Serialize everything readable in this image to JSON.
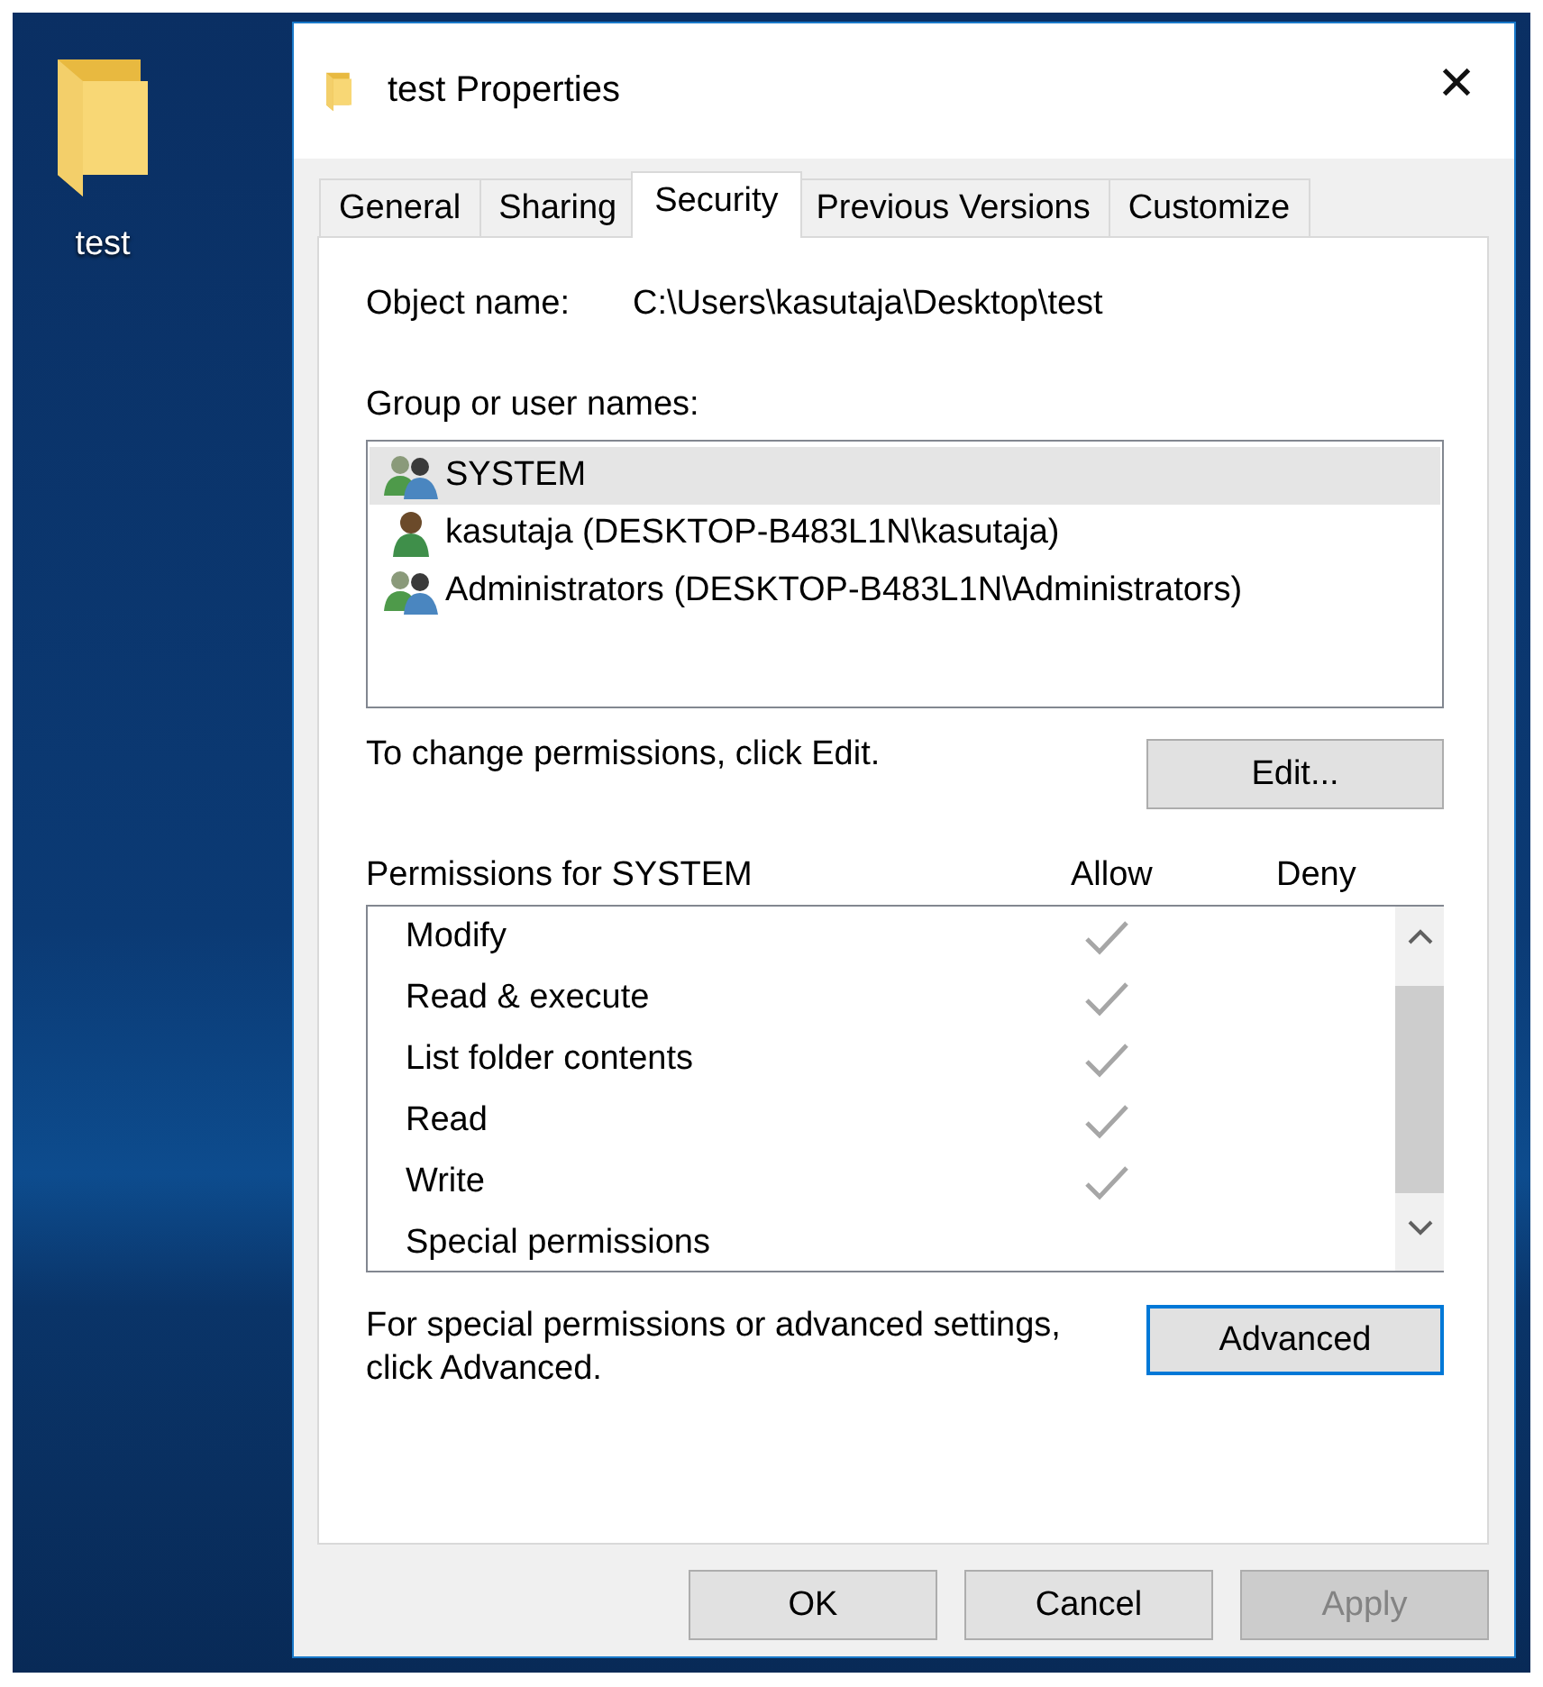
{
  "desktop": {
    "icons": [
      {
        "label": "test"
      }
    ]
  },
  "window": {
    "title": "test Properties",
    "close": "✕"
  },
  "tabs": [
    {
      "label": "General",
      "selected": false
    },
    {
      "label": "Sharing",
      "selected": false
    },
    {
      "label": "Security",
      "selected": true
    },
    {
      "label": "Previous Versions",
      "selected": false
    },
    {
      "label": "Customize",
      "selected": false
    }
  ],
  "object_name": {
    "label": "Object name:",
    "value": "C:\\Users\\kasutaja\\Desktop\\test"
  },
  "users": {
    "label": "Group or user names:",
    "items": [
      {
        "name": "SYSTEM",
        "kind": "group",
        "selected": true
      },
      {
        "name": "kasutaja (DESKTOP-B483L1N\\kasutaja)",
        "kind": "user",
        "selected": false
      },
      {
        "name": "Administrators (DESKTOP-B483L1N\\Administrators)",
        "kind": "group",
        "selected": false
      }
    ]
  },
  "edit_hint": "To change permissions, click Edit.",
  "edit_button": "Edit...",
  "permissions": {
    "label": "Permissions for SYSTEM",
    "allow_header": "Allow",
    "deny_header": "Deny",
    "rows": [
      {
        "name": "Modify",
        "allow": true,
        "deny": false
      },
      {
        "name": "Read & execute",
        "allow": true,
        "deny": false
      },
      {
        "name": "List folder contents",
        "allow": true,
        "deny": false
      },
      {
        "name": "Read",
        "allow": true,
        "deny": false
      },
      {
        "name": "Write",
        "allow": true,
        "deny": false
      },
      {
        "name": "Special permissions",
        "allow": false,
        "deny": false
      }
    ]
  },
  "advanced_hint": "For special permissions or advanced settings, click Advanced.",
  "advanced_button": "Advanced",
  "buttons": [
    {
      "label": "OK",
      "disabled": false
    },
    {
      "label": "Cancel",
      "disabled": false
    },
    {
      "label": "Apply",
      "disabled": true
    }
  ]
}
